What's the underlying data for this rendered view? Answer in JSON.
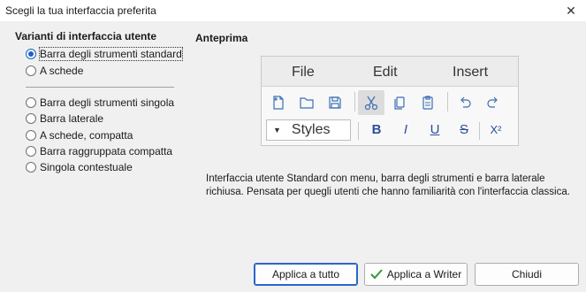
{
  "window": {
    "title": "Scegli la tua interfaccia preferita",
    "close_glyph": "✕"
  },
  "left": {
    "heading": "Varianti di interfaccia utente",
    "group1": [
      {
        "label": "Barra degli strumenti standard",
        "checked": true
      },
      {
        "label": "A schede",
        "checked": false
      }
    ],
    "group2": [
      {
        "label": "Barra degli strumenti singola",
        "checked": false
      },
      {
        "label": "Barra laterale",
        "checked": false
      },
      {
        "label": "A schede, compatta",
        "checked": false
      },
      {
        "label": "Barra raggruppata compatta",
        "checked": false
      },
      {
        "label": "Singola contestuale",
        "checked": false
      }
    ]
  },
  "preview": {
    "heading": "Anteprima",
    "menu": [
      "File",
      "Edit",
      "Insert"
    ],
    "toolbar_icons": [
      "new-document-icon",
      "open-folder-icon",
      "save-icon",
      "cut-icon",
      "copy-icon",
      "paste-icon",
      "undo-icon",
      "redo-icon"
    ],
    "styles_label": "Styles",
    "styles_caret": "▼",
    "format": {
      "bold": "B",
      "italic": "I",
      "underline": "U",
      "strike": "S",
      "superscript": "X²"
    },
    "accent_color": "#2a4f9a"
  },
  "description": "Interfaccia utente Standard con menu, barra degli strumenti e barra laterale richiusa. Pensata per quegli utenti che hanno familiarità con l'interfaccia classica.",
  "buttons": {
    "apply_all": "Applica a tutto",
    "apply_writer": "Applica a Writer",
    "close": "Chiudi"
  }
}
